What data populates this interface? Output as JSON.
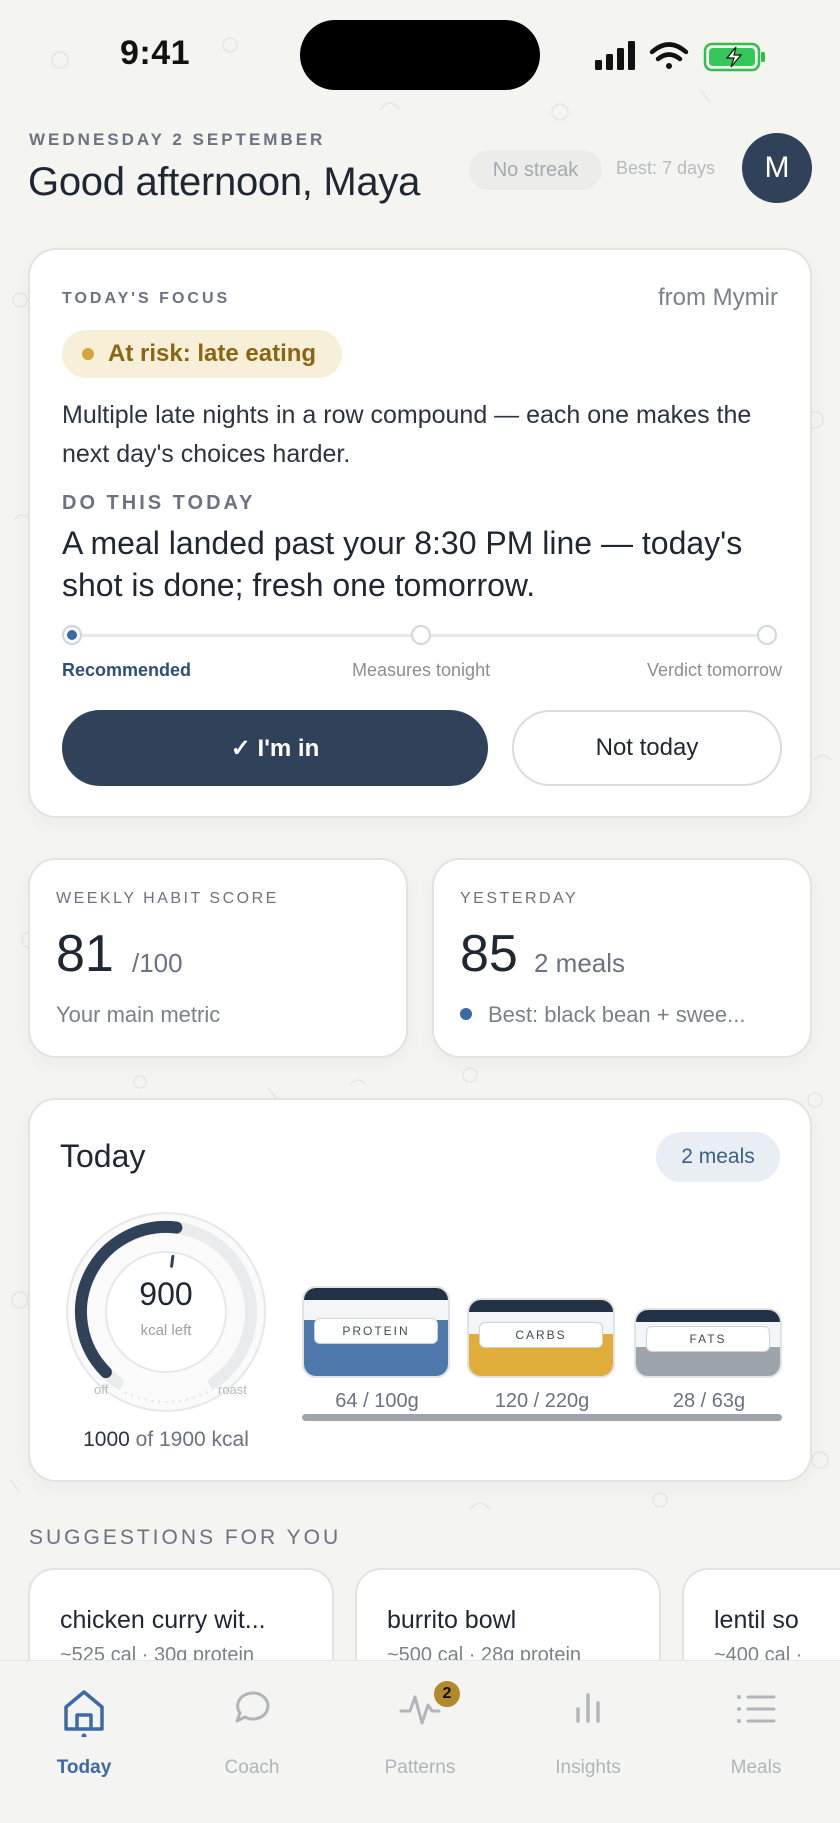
{
  "status_bar": {
    "time": "9:41"
  },
  "header": {
    "date": "WEDNESDAY 2 SEPTEMBER",
    "greeting": "Good afternoon, Maya",
    "streak": "No streak",
    "best": "Best: 7 days",
    "avatar_initial": "M"
  },
  "focus": {
    "eyebrow": "TODAY'S FOCUS",
    "source": "from Mymir",
    "risk_label": "At risk: late eating",
    "body": "Multiple late nights in a row compound — each one makes the next day's choices harder.",
    "do_eyebrow": "DO THIS TODAY",
    "action": "A meal landed past your 8:30 PM line — today's shot is done; fresh one tomorrow.",
    "steps": [
      "Recommended",
      "Measures tonight",
      "Verdict tomorrow"
    ],
    "primary_button": "✓ I'm in",
    "secondary_button": "Not today",
    "colors": {
      "accent": "#2f4259",
      "risk": "#d4a63a"
    }
  },
  "weekly": {
    "eyebrow": "WEEKLY HABIT SCORE",
    "value": "81",
    "suffix": "/100",
    "note": "Your main metric"
  },
  "yesterday": {
    "eyebrow": "YESTERDAY",
    "value": "85",
    "suffix": "2 meals",
    "note": "Best: black bean + swee..."
  },
  "today": {
    "title": "Today",
    "meals_chip": "2 meals",
    "kcal_left": "900",
    "kcal_left_unit": "kcal left",
    "gauge_left": "off",
    "gauge_right": "roast",
    "kcal_consumed": "1000",
    "kcal_total_text": "of 1900 kcal",
    "kcal_progress": 0.526,
    "macros": [
      {
        "label": "PROTEIN",
        "amount": "64 / 100g",
        "fill": 0.64,
        "color": "#4f79ad"
      },
      {
        "label": "CARBS",
        "amount": "120 / 220g",
        "fill": 0.55,
        "color": "#e0ac3a"
      },
      {
        "label": "FATS",
        "amount": "28 / 63g",
        "fill": 0.44,
        "color": "#9ea4ab"
      }
    ]
  },
  "suggestions": {
    "title": "SUGGESTIONS FOR YOU",
    "items": [
      {
        "name": "chicken curry wit...",
        "meta": "~525 cal · 30g protein"
      },
      {
        "name": "burrito bowl",
        "meta": "~500 cal · 28g protein"
      },
      {
        "name": "lentil so",
        "meta": "~400 cal ·"
      }
    ]
  },
  "tabs": [
    {
      "label": "Today",
      "icon": "home-icon",
      "active": true
    },
    {
      "label": "Coach",
      "icon": "chat-bubble-icon"
    },
    {
      "label": "Patterns",
      "icon": "pulse-icon",
      "badge": "2"
    },
    {
      "label": "Insights",
      "icon": "bar-chart-icon"
    },
    {
      "label": "Meals",
      "icon": "list-icon"
    }
  ]
}
